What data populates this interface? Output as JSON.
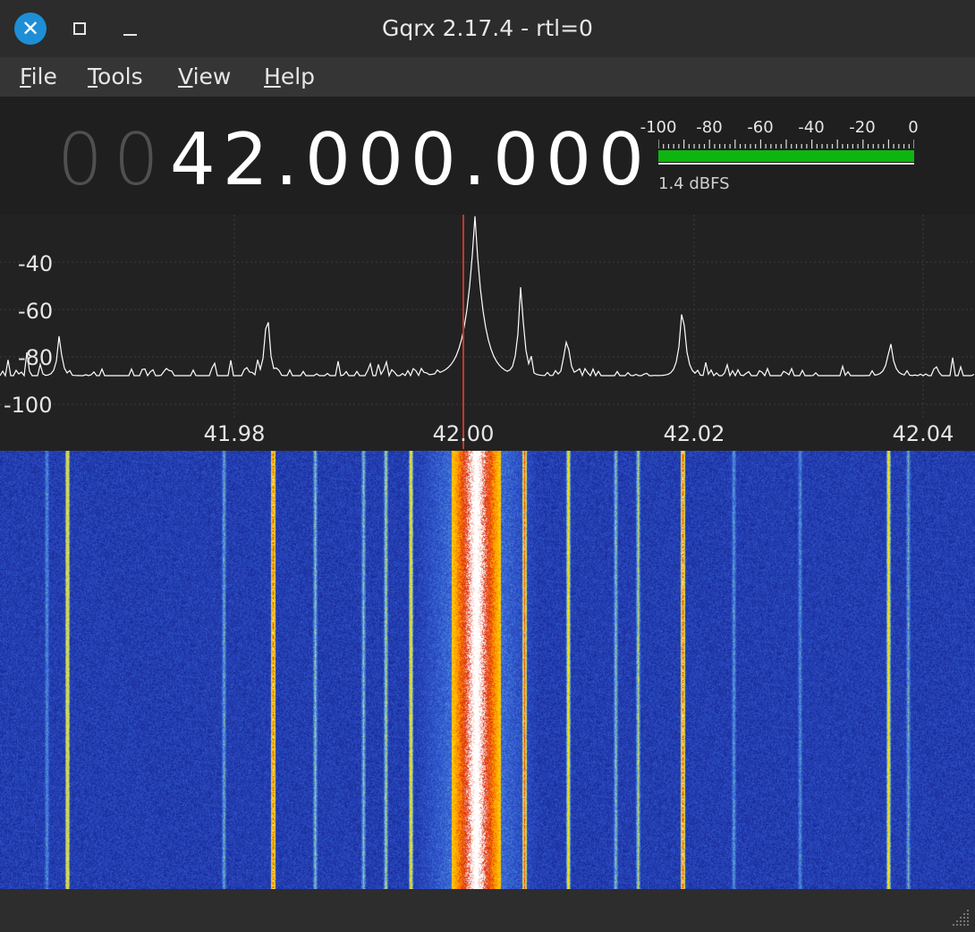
{
  "window": {
    "title": "Gqrx 2.17.4 - rtl=0",
    "close_glyph": "✕"
  },
  "menu": [
    {
      "name": "file",
      "label": "File",
      "mnemonic": "F",
      "rest": "ile"
    },
    {
      "name": "tools",
      "label": "Tools",
      "mnemonic": "T",
      "rest": "ools"
    },
    {
      "name": "view",
      "label": "View",
      "mnemonic": "V",
      "rest": "iew"
    },
    {
      "name": "help",
      "label": "Help",
      "mnemonic": "H",
      "rest": "elp"
    }
  ],
  "frequency": {
    "leading_digits": [
      "0",
      "0"
    ],
    "value": "42.000.000"
  },
  "meter": {
    "ticks": [
      "-100",
      "-80",
      "-60",
      "-40",
      "-20",
      "0"
    ],
    "value_text": "1.4 dBFS",
    "level_fraction": 1.0,
    "bar_color": "#0fb50f"
  },
  "spectrum": {
    "y_ticks": [
      "-40",
      "-60",
      "-80",
      "-100"
    ],
    "x_ticks": [
      "41.98",
      "42.00",
      "42.02",
      "42.04"
    ],
    "center_freq_mhz": 42.0,
    "line_color": "#ffffff",
    "marker_color": "#c0392b",
    "peaks_mhz": [
      41.965,
      41.983,
      42.001,
      42.005,
      42.009,
      42.019,
      42.037
    ]
  },
  "waterfall": {
    "background_color": "#2a3fc0",
    "signal_colors": [
      "#ffe600",
      "#ff8c00",
      "#e8280a",
      "#ffffff"
    ]
  }
}
